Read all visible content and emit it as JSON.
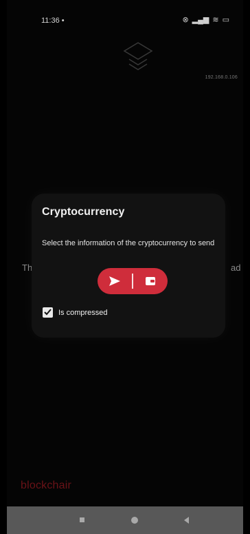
{
  "status_bar": {
    "time": "11:36",
    "time_suffix": "•",
    "icons": [
      "alarm-icon",
      "signal-icon",
      "wifi-icon",
      "battery-icon"
    ]
  },
  "background": {
    "ip_address": "192.168.0.106",
    "left_fragment": "Th",
    "right_fragment": "ad",
    "brand": "blockchair"
  },
  "dialog": {
    "title": "Cryptocurrency",
    "message": "Select the information of the cryptocurrency to send",
    "actions": [
      "send",
      "wallet"
    ],
    "checkbox_label": "Is compressed",
    "checkbox_checked": true
  },
  "colors": {
    "accent": "#cf2d3b",
    "dialog_bg": "#121212",
    "navbar_bg": "#585858"
  },
  "nav_bar": {
    "buttons": [
      "recent-apps",
      "home",
      "back"
    ]
  }
}
